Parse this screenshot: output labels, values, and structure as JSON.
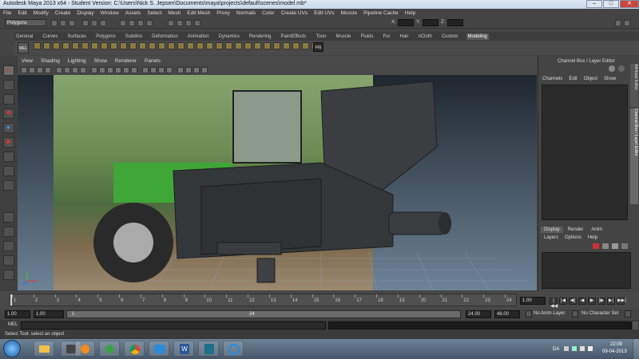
{
  "window": {
    "title": "Autodesk Maya 2013 x64 - Student Version: C:\\Users\\Nick S. Jepsen\\Documents\\maya\\projects\\default\\scenes\\model.mb*",
    "minimize": "–",
    "maximize": "□",
    "close": "✕"
  },
  "menubar": [
    "File",
    "Edit",
    "Modify",
    "Create",
    "Display",
    "Window",
    "Assets",
    "Select",
    "Mesh",
    "Edit Mesh",
    "Proxy",
    "Normals",
    "Color",
    "Create UVs",
    "Edit UVs",
    "Muscle",
    "Pipeline Cache",
    "Help"
  ],
  "statusline": {
    "mode": "Polygons",
    "x_label": "X:",
    "y_label": "Y:",
    "z_label": "Z:"
  },
  "shelf": {
    "tabs": [
      "General",
      "Curves",
      "Surfaces",
      "Polygons",
      "Subdivs",
      "Deformation",
      "Animation",
      "Dynamics",
      "Rendering",
      "PaintEffects",
      "Toon",
      "Muscle",
      "Fluids",
      "Fur",
      "Hair",
      "nCloth",
      "Custom",
      "Modeling"
    ],
    "active_tab": "Modeling",
    "mel_label": "MEL",
    "fn_label": "FN"
  },
  "viewport": {
    "menu": [
      "View",
      "Shading",
      "Lighting",
      "Show",
      "Renderer",
      "Panels"
    ]
  },
  "channel_box": {
    "title": "Channel Box / Layer Editor",
    "menu": [
      "Channels",
      "Edit",
      "Object",
      "Show"
    ],
    "side_tabs": [
      "Attribute Editor",
      "Channel Box / Layer Editor"
    ]
  },
  "layer_editor": {
    "tabs": [
      "Display",
      "Render",
      "Anim"
    ],
    "menu": [
      "Layers",
      "Options",
      "Help"
    ]
  },
  "timeline": {
    "ticks": [
      "1",
      "2",
      "3",
      "4",
      "5",
      "6",
      "7",
      "8",
      "9",
      "10",
      "11",
      "12",
      "13",
      "14",
      "15",
      "16",
      "17",
      "18",
      "19",
      "20",
      "21",
      "22",
      "23",
      "24"
    ],
    "current_frame": "1.00",
    "playback_buttons": [
      "|◀◀",
      "|◀",
      "◀|",
      "◀",
      "▶",
      "|▶",
      "▶|",
      "▶▶|"
    ]
  },
  "range": {
    "start": "1.00",
    "anim_start": "1.00",
    "slider_start": "1",
    "slider_end": "24",
    "end": "24.00",
    "anim_end": "48.00",
    "anim_layer": "No Anim Layer",
    "character_set": "No Character Set"
  },
  "mel": {
    "label": "MEL"
  },
  "help_line": {
    "text": "Select Tool: select an object"
  },
  "taskbar": {
    "language": "DA",
    "time": "22:09",
    "date": "09-04-2013"
  },
  "colors": {
    "maya_bg": "#444444",
    "viewport_top": "#1f262e",
    "viewport_bottom": "#6d8396",
    "tractor_green": "#3fa638",
    "model_grey": "#3b3d40",
    "taskbar": "#56697d"
  }
}
